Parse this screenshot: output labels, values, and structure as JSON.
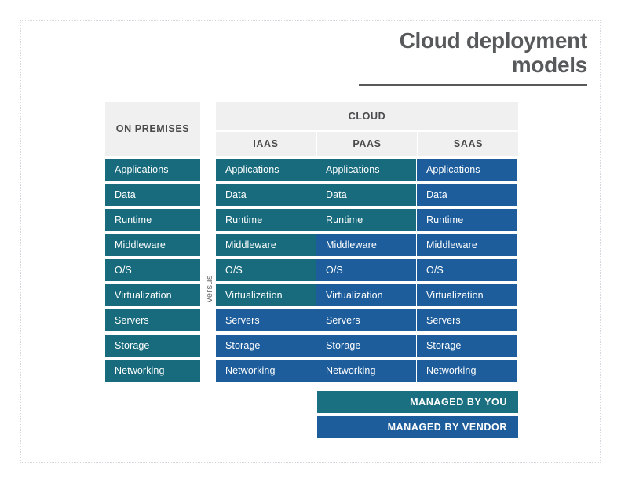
{
  "title": {
    "line1": "Cloud deployment",
    "line2": "models"
  },
  "headers": {
    "on_premises": "ON PREMISES",
    "cloud": "CLOUD",
    "iaas": "IAAS",
    "paas": "PAAS",
    "saas": "SAAS"
  },
  "versus_label": "versus",
  "colors": {
    "managed_by_you": "#176b7c",
    "managed_by_vendor": "#1d5d9c",
    "header_background": "#f0f0f1",
    "header_text": "#4a4a4c",
    "title_text": "#58595b",
    "frame": "#d8d4dd"
  },
  "legend": [
    {
      "label": "MANAGED BY YOU",
      "owner": "you"
    },
    {
      "label": "MANAGED BY VENDOR",
      "owner": "vendor"
    }
  ],
  "layers": [
    "Applications",
    "Data",
    "Runtime",
    "Middleware",
    "O/S",
    "Virtualization",
    "Servers",
    "Storage",
    "Networking"
  ],
  "columns": {
    "on_premises": {
      "name": "ON PREMISES",
      "cells": [
        {
          "label": "Applications",
          "owner": "you"
        },
        {
          "label": "Data",
          "owner": "you"
        },
        {
          "label": "Runtime",
          "owner": "you"
        },
        {
          "label": "Middleware",
          "owner": "you"
        },
        {
          "label": "O/S",
          "owner": "you"
        },
        {
          "label": "Virtualization",
          "owner": "you"
        },
        {
          "label": "Servers",
          "owner": "you"
        },
        {
          "label": "Storage",
          "owner": "you"
        },
        {
          "label": "Networking",
          "owner": "you"
        }
      ]
    },
    "iaas": {
      "name": "IAAS",
      "cells": [
        {
          "label": "Applications",
          "owner": "you"
        },
        {
          "label": "Data",
          "owner": "you"
        },
        {
          "label": "Runtime",
          "owner": "you"
        },
        {
          "label": "Middleware",
          "owner": "you"
        },
        {
          "label": "O/S",
          "owner": "you"
        },
        {
          "label": "Virtualization",
          "owner": "you"
        },
        {
          "label": "Servers",
          "owner": "vendor"
        },
        {
          "label": "Storage",
          "owner": "vendor"
        },
        {
          "label": "Networking",
          "owner": "vendor"
        }
      ]
    },
    "paas": {
      "name": "PAAS",
      "cells": [
        {
          "label": "Applications",
          "owner": "you"
        },
        {
          "label": "Data",
          "owner": "you"
        },
        {
          "label": "Runtime",
          "owner": "you"
        },
        {
          "label": "Middleware",
          "owner": "vendor"
        },
        {
          "label": "O/S",
          "owner": "vendor"
        },
        {
          "label": "Virtualization",
          "owner": "vendor"
        },
        {
          "label": "Servers",
          "owner": "vendor"
        },
        {
          "label": "Storage",
          "owner": "vendor"
        },
        {
          "label": "Networking",
          "owner": "vendor"
        }
      ]
    },
    "saas": {
      "name": "SAAS",
      "cells": [
        {
          "label": "Applications",
          "owner": "vendor"
        },
        {
          "label": "Data",
          "owner": "vendor"
        },
        {
          "label": "Runtime",
          "owner": "vendor"
        },
        {
          "label": "Middleware",
          "owner": "vendor"
        },
        {
          "label": "O/S",
          "owner": "vendor"
        },
        {
          "label": "Virtualization",
          "owner": "vendor"
        },
        {
          "label": "Servers",
          "owner": "vendor"
        },
        {
          "label": "Storage",
          "owner": "vendor"
        },
        {
          "label": "Networking",
          "owner": "vendor"
        }
      ]
    }
  }
}
